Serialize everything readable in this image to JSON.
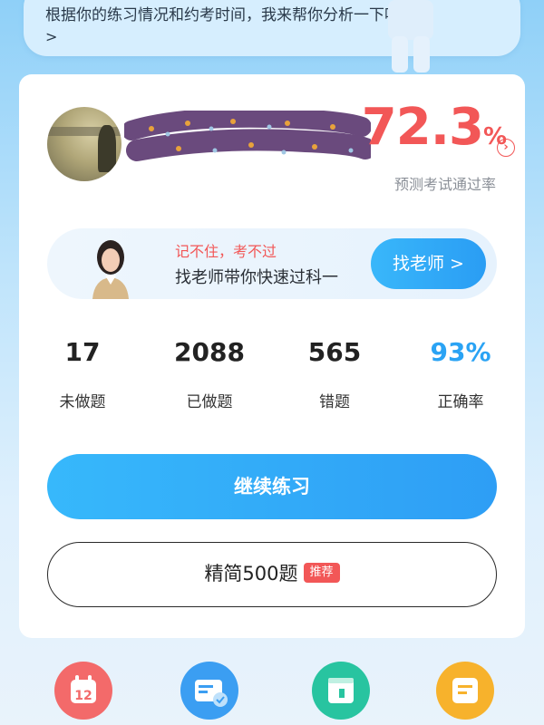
{
  "bubble": {
    "text": "根据你的练习情况和约考时间，我来帮你分析一下吧",
    "arrow": ">"
  },
  "prediction": {
    "rate": "72.3",
    "unit": "%",
    "label": "预测考试通过率"
  },
  "banner": {
    "line1": "记不住，考不过",
    "line2": "找老师带你快速过科一",
    "button": "找老师 >"
  },
  "stats": [
    {
      "value": "17",
      "label": "未做题"
    },
    {
      "value": "2088",
      "label": "已做题"
    },
    {
      "value": "565",
      "label": "错题"
    },
    {
      "value": "93%",
      "label": "正确率"
    }
  ],
  "actions": {
    "continue": "继续练习",
    "refined": "精简500题",
    "refined_tag": "推荐"
  },
  "bottom_icons": {
    "calendar_day": "12"
  },
  "colors": {
    "accent_blue": "#2e9ef5",
    "accent_red": "#f25757"
  }
}
